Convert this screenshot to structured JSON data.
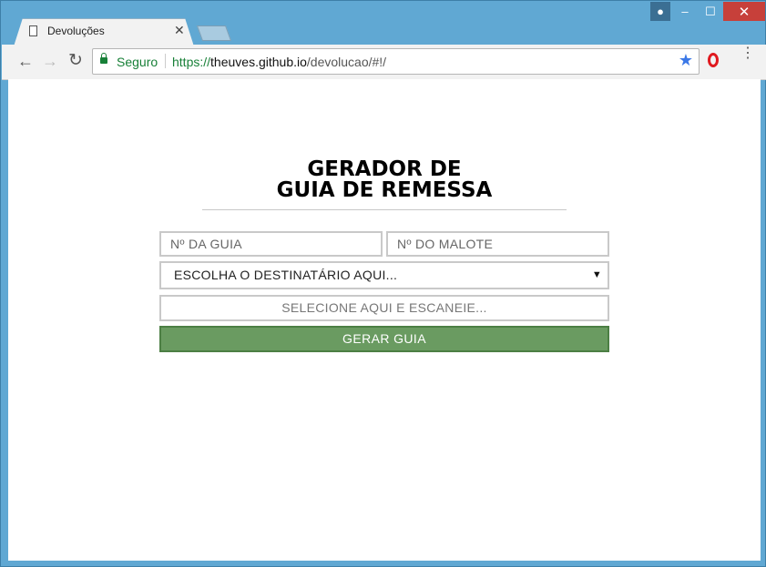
{
  "window": {
    "controls": {
      "minimize": "–",
      "maximize": "☐",
      "close": "✕"
    }
  },
  "tab": {
    "title": "Devoluções",
    "close": "✕"
  },
  "toolbar": {
    "back": "←",
    "forward": "→",
    "reload": "↻",
    "secure_label": "Seguro",
    "url_scheme": "https://",
    "url_host": "theuves.github.io",
    "url_path": "/devolucao/#!/",
    "star": "★",
    "menu": "⋮"
  },
  "page": {
    "title_line1": "GERADOR DE",
    "title_line2": "GUIA DE REMESSA",
    "guia_placeholder": "Nº DA GUIA",
    "malote_placeholder": "Nº DO MALOTE",
    "destinatario_selected": "ESCOLHA O DESTINATÁRIO AQUI...",
    "scan_placeholder": "SELECIONE AQUI E ESCANEIE...",
    "generate_button": "GERAR GUIA"
  },
  "colors": {
    "button_green": "#6a9b61",
    "secure_green": "#188038",
    "frame_blue": "#60a8d3"
  }
}
